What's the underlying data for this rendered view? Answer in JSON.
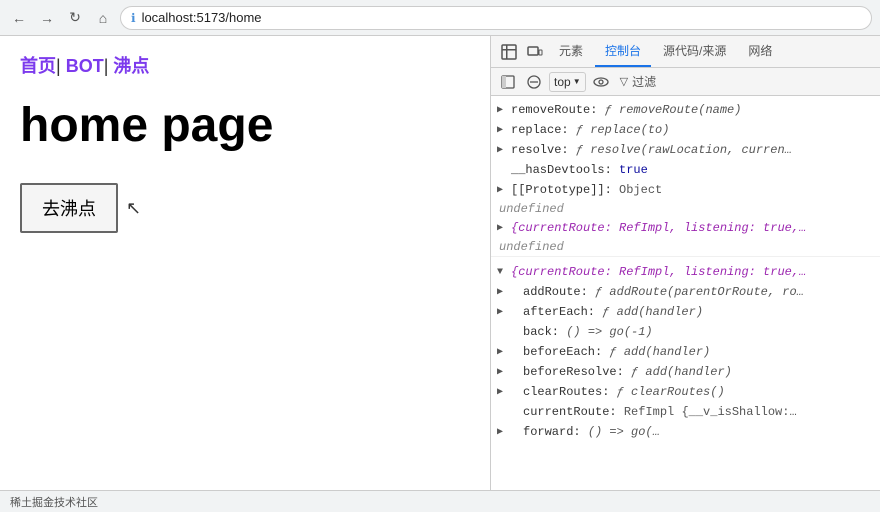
{
  "browser": {
    "url": "localhost:5173/home",
    "back_btn": "←",
    "forward_btn": "→",
    "reload_btn": "↻",
    "home_btn": "⌂"
  },
  "page": {
    "nav": {
      "home_link": "首页",
      "bot_link": "BOT",
      "boiling_link": "沸点",
      "sep1": "|",
      "sep2": "|"
    },
    "title": "home page",
    "button_label": "去沸点"
  },
  "devtools": {
    "tabs": [
      {
        "label": "元素",
        "id": "elements"
      },
      {
        "label": "控制台",
        "id": "console",
        "active": true
      },
      {
        "label": "源代码/来源",
        "id": "sources"
      },
      {
        "label": "网络",
        "id": "network"
      }
    ],
    "tab_icons": [
      "inspector",
      "responsive",
      "console-icon"
    ],
    "toolbar": {
      "top_selector": "top",
      "filter_label": "过滤"
    },
    "console_lines": [
      {
        "type": "prop",
        "toggle": true,
        "key": "removeRoute:",
        "val": "ƒ removeRoute(name)"
      },
      {
        "type": "prop",
        "toggle": true,
        "key": "replace:",
        "val": "ƒ replace(to)"
      },
      {
        "type": "prop",
        "toggle": true,
        "key": "resolve:",
        "val": "ƒ resolve(rawLocation, curren…"
      },
      {
        "type": "prop",
        "toggle": false,
        "key": "__hasDevtools:",
        "val": "true",
        "val_type": "bool"
      },
      {
        "type": "prop",
        "toggle": true,
        "key": "[[Prototype]]:",
        "val": "Object"
      },
      {
        "type": "undefined"
      },
      {
        "type": "obj-collapsed",
        "text": "{currentRoute: RefImpl, listening: true,…"
      },
      {
        "type": "undefined"
      },
      {
        "type": "gap"
      },
      {
        "type": "obj-expanded",
        "text": "{currentRoute: RefImpl, listening: true,…"
      },
      {
        "type": "prop-indent",
        "toggle": true,
        "key": "addRoute:",
        "val": "ƒ addRoute(parentOrRoute, ro…"
      },
      {
        "type": "prop-indent",
        "toggle": true,
        "key": "afterEach:",
        "val": "ƒ add(handler)"
      },
      {
        "type": "prop-indent",
        "toggle": false,
        "key": "back:",
        "val": "() => go(-1)",
        "val_type": "fn"
      },
      {
        "type": "prop-indent",
        "toggle": true,
        "key": "beforeEach:",
        "val": "ƒ add(handler)"
      },
      {
        "type": "prop-indent",
        "toggle": true,
        "key": "beforeResolve:",
        "val": "ƒ add(handler)"
      },
      {
        "type": "prop-indent",
        "toggle": true,
        "key": "clearRoutes:",
        "val": "ƒ clearRoutes()"
      },
      {
        "type": "prop-indent",
        "toggle": false,
        "key": "currentRoute:",
        "val": "RefImpl {__v_isShallow:…"
      },
      {
        "type": "prop-indent",
        "toggle": true,
        "key": "forward:",
        "val": "() => go(…"
      }
    ]
  },
  "statusbar": {
    "text": "稀土掘金技术社区"
  }
}
